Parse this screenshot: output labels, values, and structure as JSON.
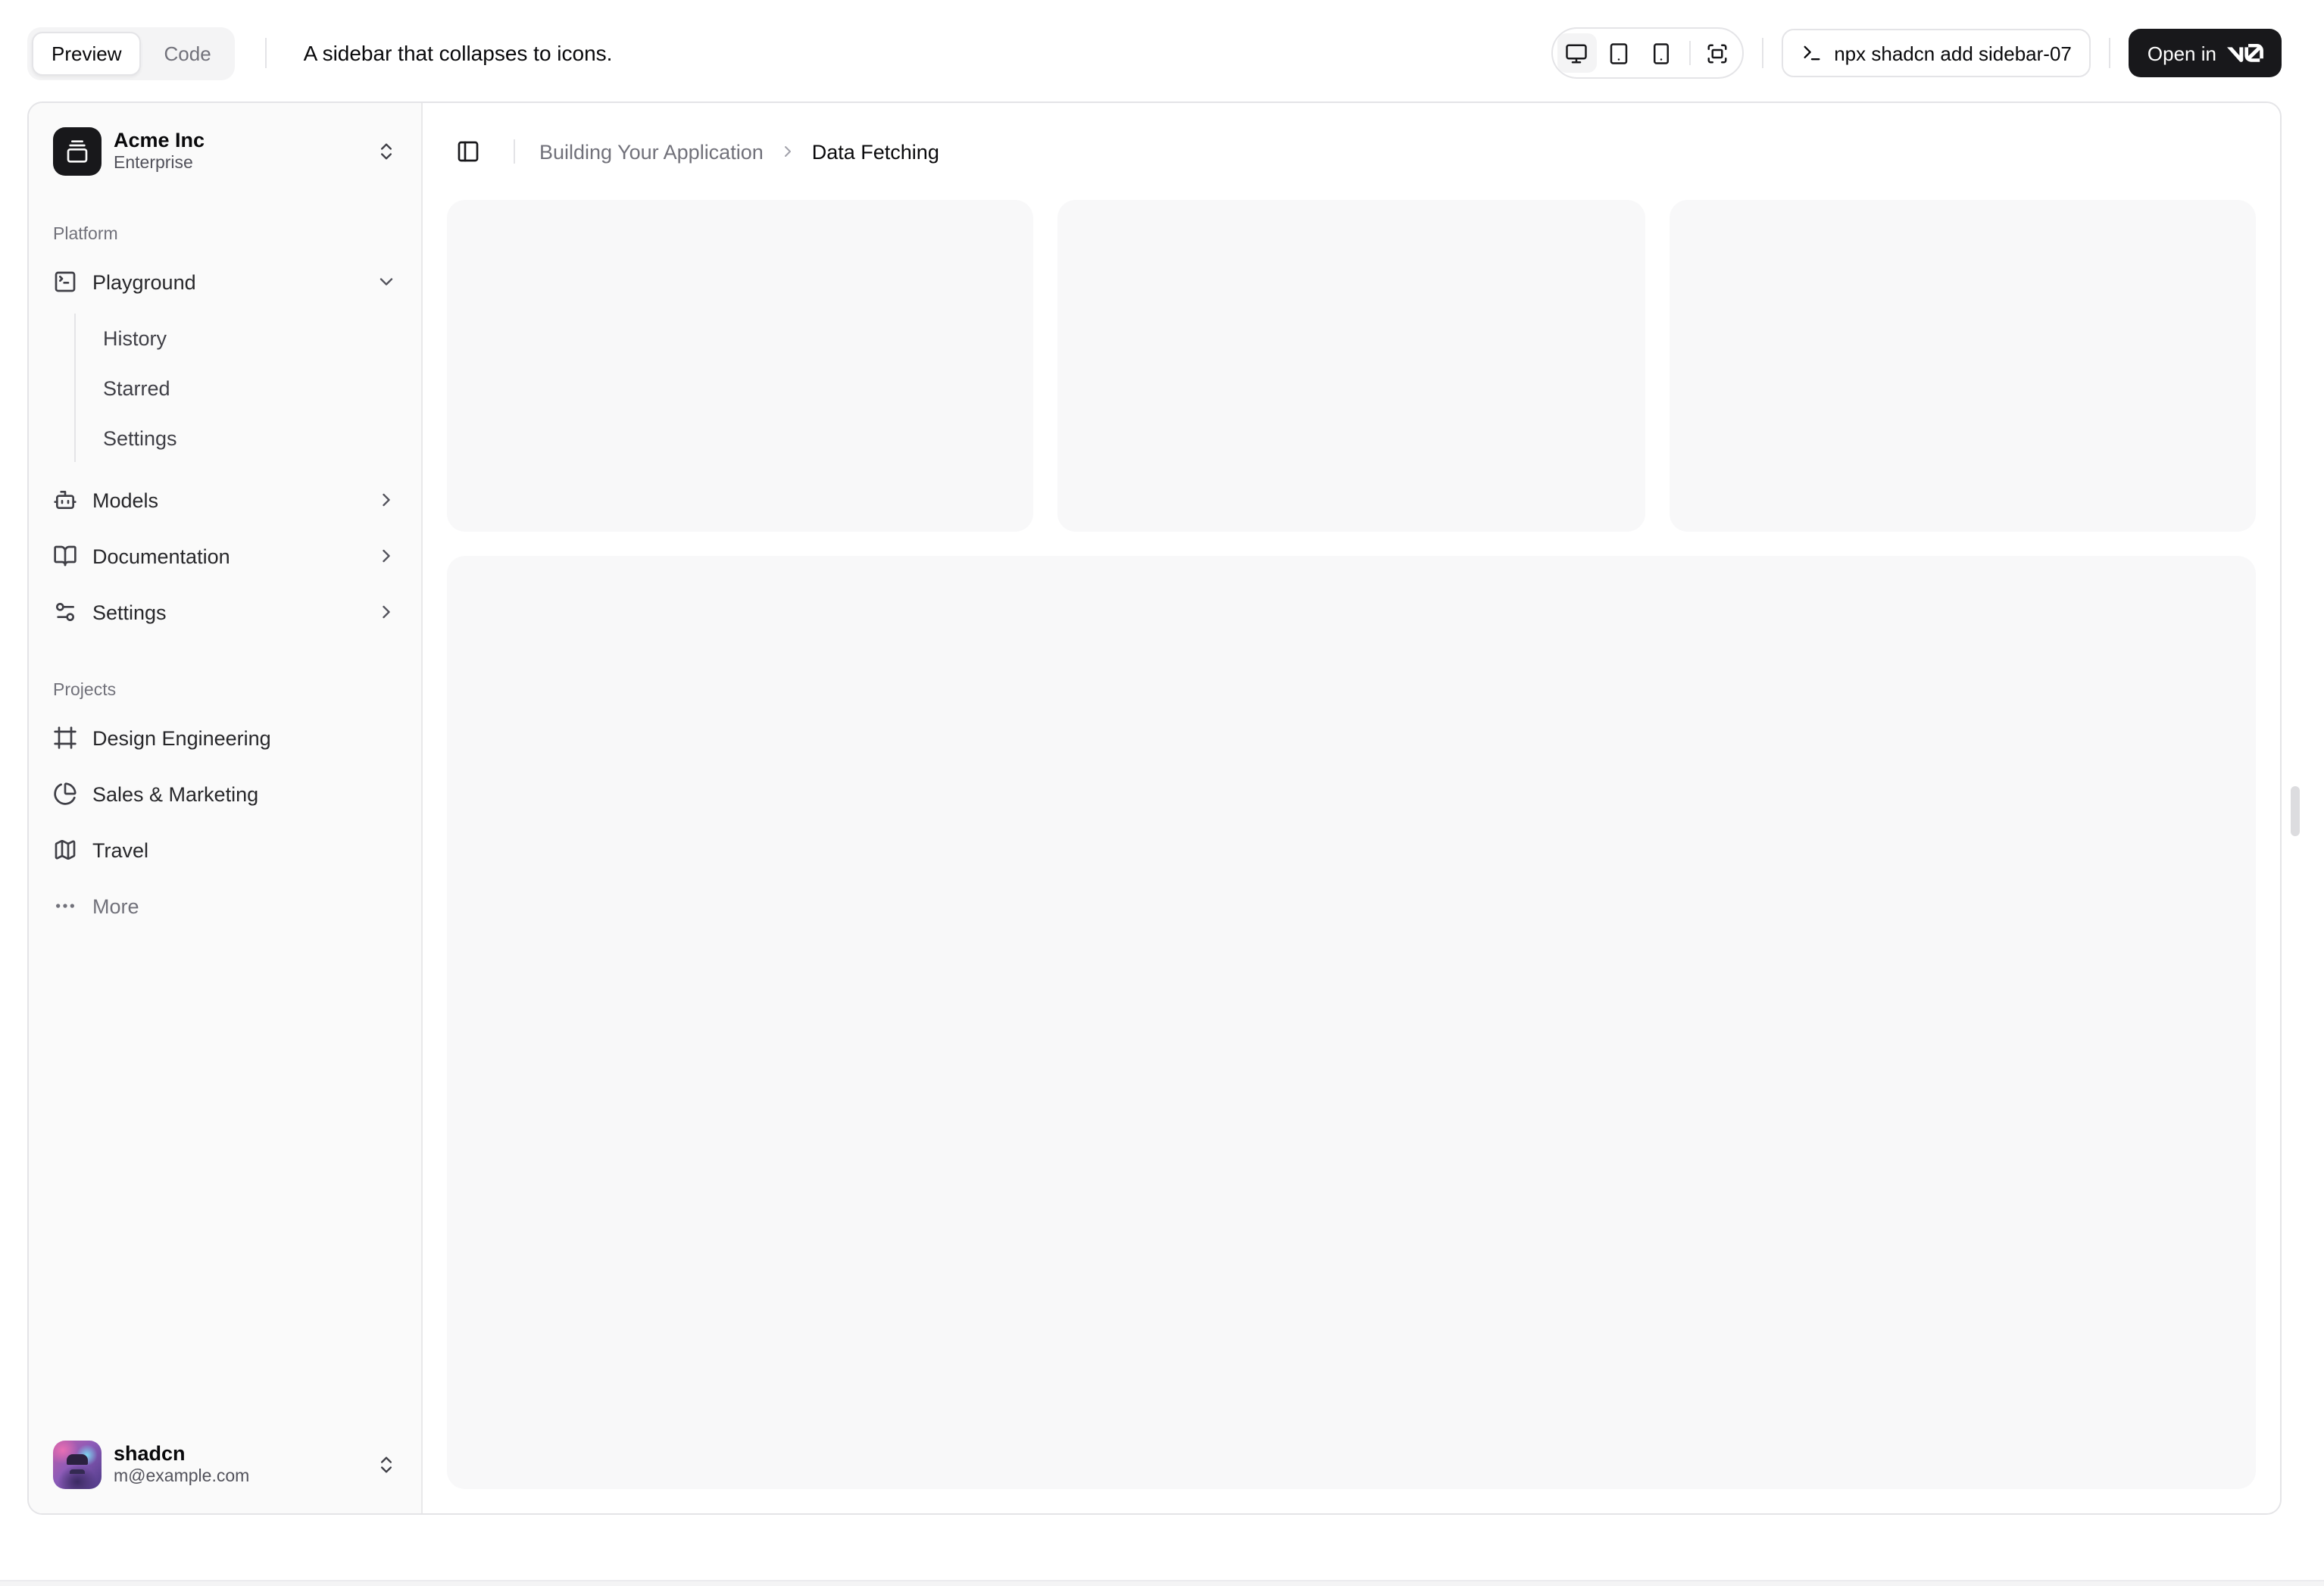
{
  "toolbar": {
    "preview_tab": "Preview",
    "code_tab": "Code",
    "description": "A sidebar that collapses to icons.",
    "command": "npx shadcn add sidebar-07",
    "open_in_label": "Open in"
  },
  "sidebar": {
    "team": {
      "name": "Acme Inc",
      "plan": "Enterprise"
    },
    "platform": {
      "label": "Platform",
      "playground": {
        "label": "Playground",
        "children": [
          "History",
          "Starred",
          "Settings"
        ]
      },
      "models": "Models",
      "documentation": "Documentation",
      "settings": "Settings"
    },
    "projects": {
      "label": "Projects",
      "design_engineering": "Design Engineering",
      "sales_marketing": "Sales & Marketing",
      "travel": "Travel",
      "more": "More"
    },
    "user": {
      "name": "shadcn",
      "email": "m@example.com"
    }
  },
  "main": {
    "breadcrumb": {
      "parent": "Building Your Application",
      "separator": "›",
      "current": "Data Fetching"
    }
  },
  "colors": {
    "accent": "#18181b",
    "border": "#e4e4e7",
    "sidebar_bg": "#fafafa",
    "muted_text": "#71717a",
    "placeholder_bg": "#f8f8f9"
  }
}
